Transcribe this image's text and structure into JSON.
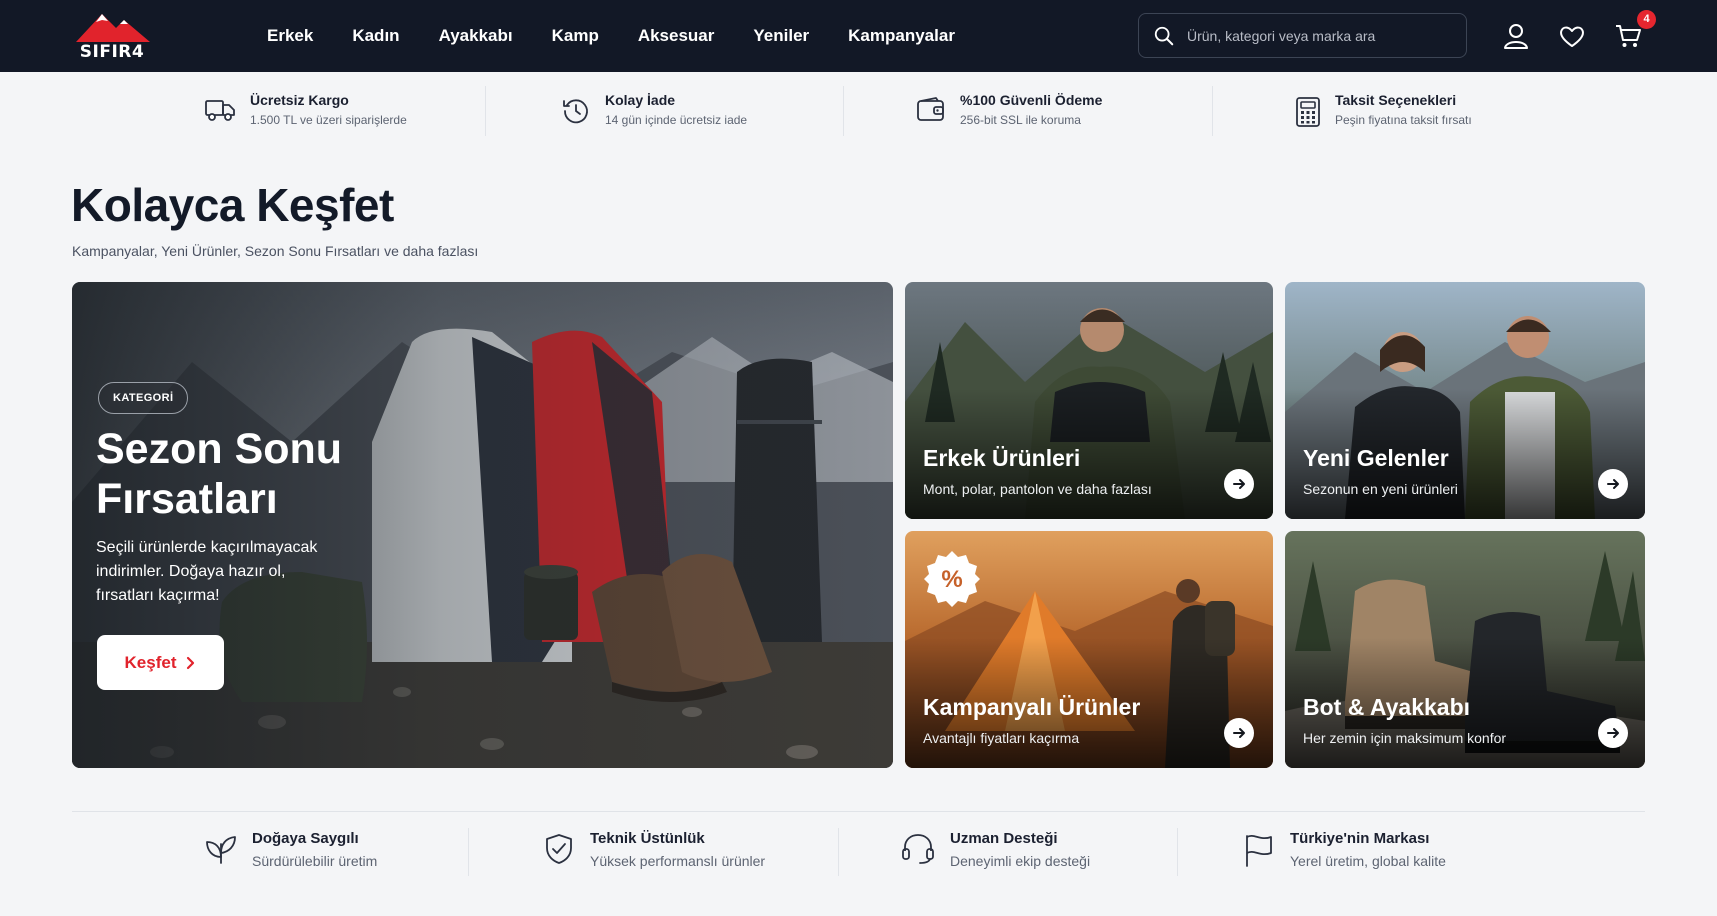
{
  "brand": {
    "name": "SIFIR4"
  },
  "nav": {
    "items": [
      "Erkek",
      "Kadın",
      "Ayakkabı",
      "Kamp",
      "Aksesuar",
      "Yeniler",
      "Kampanyalar"
    ]
  },
  "search": {
    "placeholder": "Ürün, kategori veya marka ara"
  },
  "header_icons": [
    "user-icon",
    "heart-icon",
    "cart-icon"
  ],
  "cart": {
    "count": "4"
  },
  "benefits": [
    {
      "icon": "truck-icon",
      "title": "Ücretsiz Kargo",
      "subtitle": "1.500 TL ve üzeri siparişlerde"
    },
    {
      "icon": "return-icon",
      "title": "Kolay İade",
      "subtitle": "14 gün içinde ücretsiz iade"
    },
    {
      "icon": "wallet-icon",
      "title": "%100 Güvenli Ödeme",
      "subtitle": "256-bit SSL ile koruma"
    },
    {
      "icon": "calculator-icon",
      "title": "Taksit Seçenekleri",
      "subtitle": "Peşin fiyatına taksit fırsatı"
    }
  ],
  "page": {
    "title": "Kolayca Keşfet",
    "subtitle": "Kampanyalar, Yeni Ürünler, Sezon Sonu Fırsatları ve daha fazlası"
  },
  "hero": {
    "badge": "KATEGORİ",
    "title": "Sezon Sonu Fırsatları",
    "description": "Seçili ürünlerde kaçırılmayacak indirimler. Doğaya hazır ol, fırsatları kaçırma!",
    "button": "Keşfet"
  },
  "cards": [
    {
      "title": "Erkek Ürünleri",
      "subtitle": "Mont, polar, pantolon ve daha fazlası"
    },
    {
      "title": "Yeni Gelenler",
      "subtitle": "Sezonun en yeni ürünleri"
    },
    {
      "title": "Kampanyalı Ürünler",
      "subtitle": "Avantajlı fiyatları kaçırma",
      "badge": "%"
    },
    {
      "title": "Bot & Ayakkabı",
      "subtitle": "Her zemin için maksimum konfor"
    }
  ],
  "features": [
    {
      "icon": "leaf-icon",
      "title": "Doğaya Saygılı",
      "subtitle": "Sürdürülebilir üretim"
    },
    {
      "icon": "shield-check-icon",
      "title": "Teknik Üstünlük",
      "subtitle": "Yüksek performanslı ürünler"
    },
    {
      "icon": "headset-icon",
      "title": "Uzman Desteği",
      "subtitle": "Deneyimli ekip desteği"
    },
    {
      "icon": "flag-icon",
      "title": "Türkiye'nin Markası",
      "subtitle": "Yerel üretim, global kalite"
    }
  ],
  "colors": {
    "header_bg": "#121826",
    "accent_red": "#e1232c",
    "page_bg": "#f4f5f7"
  }
}
